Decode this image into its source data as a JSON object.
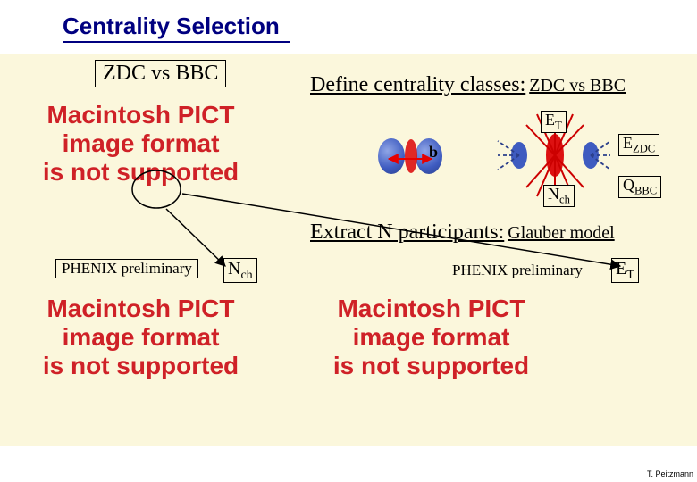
{
  "title": "Centrality Selection",
  "subtitle_box": "ZDC vs BBC",
  "define_line_main": "Define centrality classes:",
  "define_line_suffix": " ZDC vs BBC",
  "extract_line_main": "Extract N participants:",
  "extract_line_suffix": " Glauber model",
  "pict_text": "Macintosh PICT\nimage format\nis not supported",
  "phenix_label": "PHENIX preliminary",
  "vars": {
    "ET": {
      "main": "E",
      "sub": "T"
    },
    "EZDC": {
      "main": "E",
      "sub": "ZDC"
    },
    "Nch": {
      "main": "N",
      "sub": "ch"
    },
    "QBBC": {
      "main": "Q",
      "sub": "BBC"
    },
    "b": "b"
  },
  "colors": {
    "nucleus_blue": "#3e5bc0",
    "arrow_red": "#e60000",
    "spray_red": "#cc0000",
    "spray_blue": "#2b3f8b",
    "title_navy": "#000080"
  },
  "credit": "T. Peitzmann"
}
